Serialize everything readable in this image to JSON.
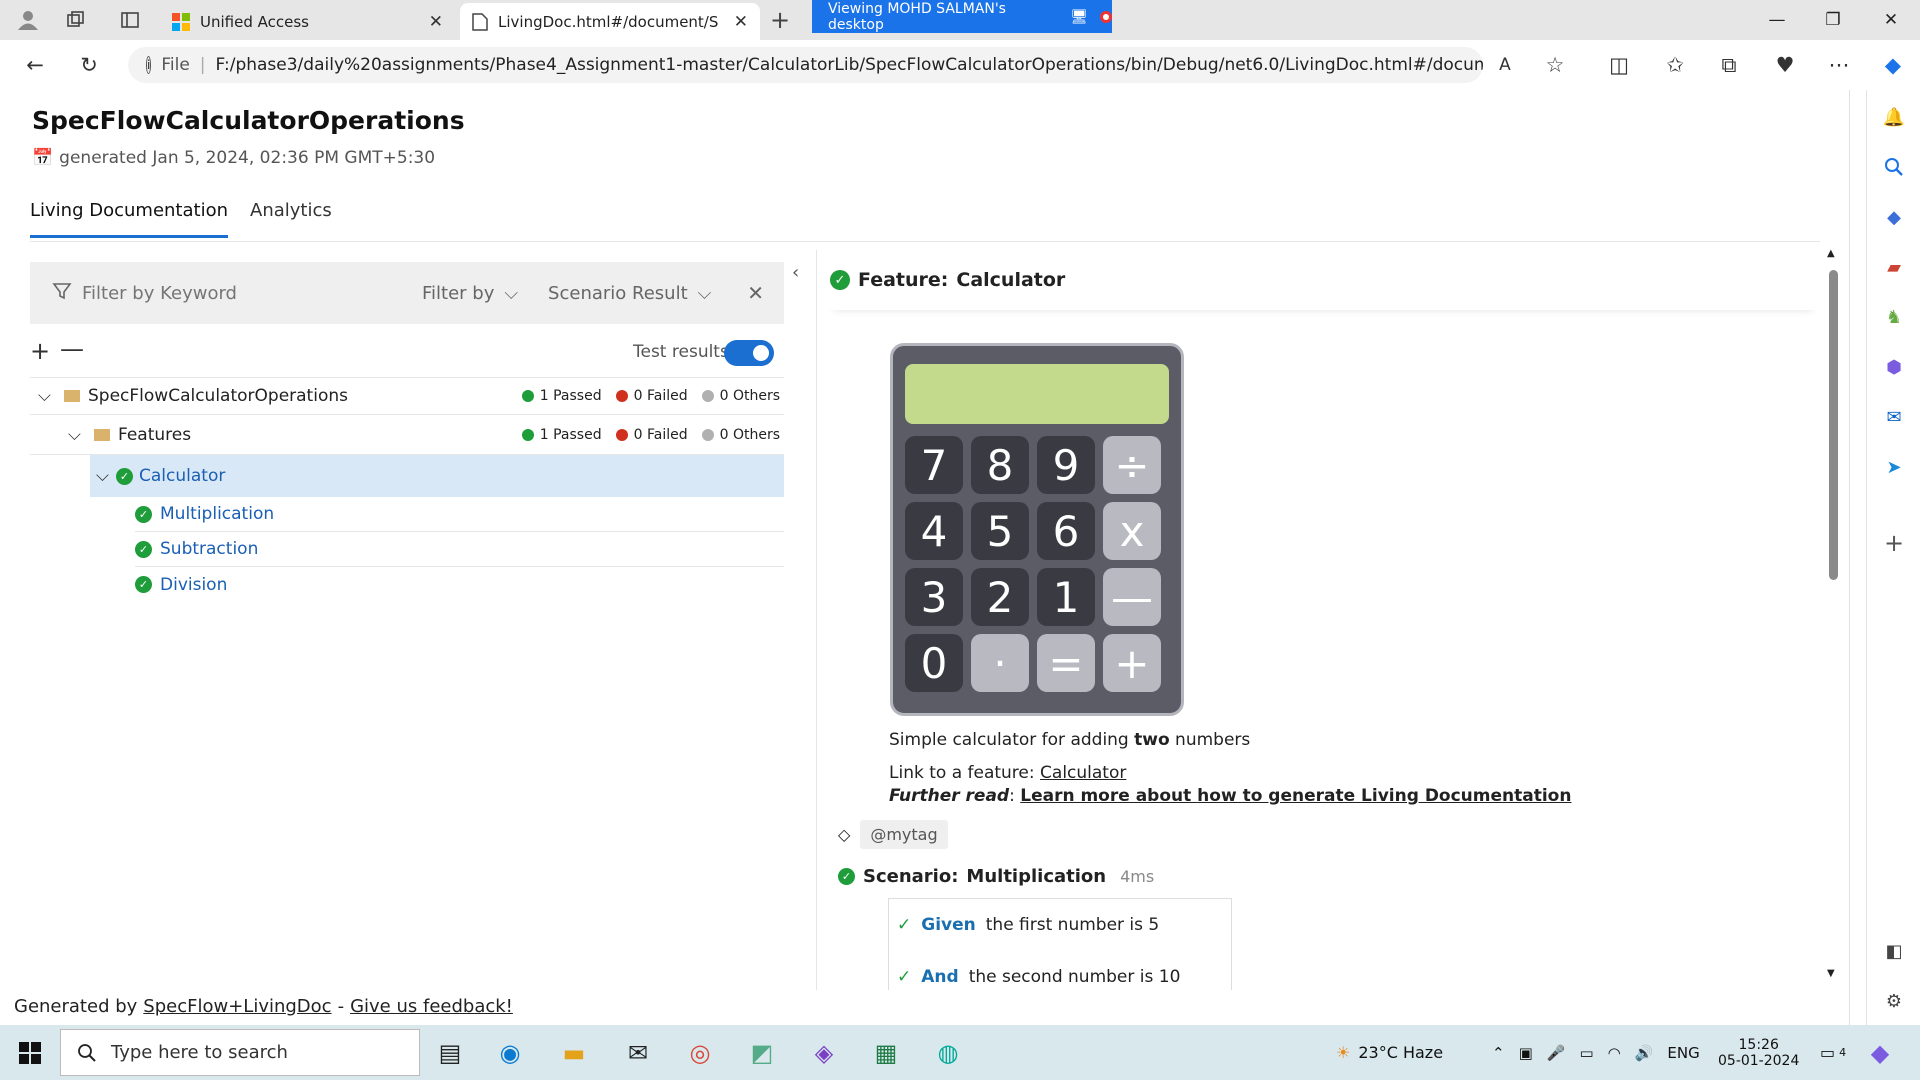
{
  "browser": {
    "tabs": [
      {
        "label": "Unified Access"
      },
      {
        "label": "LivingDoc.html#/document/Stan"
      }
    ],
    "remote_banner": "Viewing MOHD  SALMAN's desktop",
    "url_prefix": "File",
    "url": "F:/phase3/daily%20assignments/Phase4_Assignment1-master/CalculatorLib/SpecFlowCalculatorOperations/bin/Debug/net6.0/LivingDoc.html#/document/Stan..."
  },
  "page": {
    "title": "SpecFlowCalculatorOperations",
    "generated": "generated Jan 5, 2024, 02:36 PM GMT+5:30",
    "tabs": [
      "Living Documentation",
      "Analytics"
    ],
    "filter": {
      "placeholder": "Filter by Keyword",
      "filter_by": "Filter by",
      "scenario_result": "Scenario Result"
    },
    "test_results_label": "Test results",
    "tree": {
      "root": {
        "label": "SpecFlowCalculatorOperations",
        "passed": "1 Passed",
        "failed": "0 Failed",
        "others": "0 Others"
      },
      "features": {
        "label": "Features",
        "passed": "1 Passed",
        "failed": "0 Failed",
        "others": "0 Others"
      },
      "calculator": {
        "label": "Calculator"
      },
      "scenarios": [
        "Multiplication",
        "Subtraction",
        "Division"
      ]
    },
    "feature": {
      "heading_prefix": "Feature:",
      "heading_name": "Calculator",
      "calc_keys": [
        "7",
        "8",
        "9",
        "÷",
        "4",
        "5",
        "6",
        "x",
        "3",
        "2",
        "1",
        "—",
        "0",
        "·",
        "=",
        "+"
      ],
      "desc_before": "Simple calculator for adding ",
      "desc_bold": "two",
      "desc_after": " numbers",
      "link_prefix": "Link to a feature: ",
      "link_text": "Calculator",
      "further_label": "Further read",
      "further_link": "Learn more about how to generate Living Documentation",
      "tag": "@mytag",
      "scenario_prefix": "Scenario:",
      "scenario_name": "Multiplication",
      "scenario_time": "4ms",
      "steps": [
        {
          "keyword": "Given",
          "text": "the first number is 5"
        },
        {
          "keyword": "And",
          "text": "the second number is 10"
        }
      ]
    },
    "footer": {
      "prefix": "Generated by ",
      "link1": "SpecFlow+LivingDoc",
      "sep": " - ",
      "link2": "Give us feedback!"
    }
  },
  "taskbar": {
    "search_placeholder": "Type here to search",
    "weather": "23°C  Haze",
    "lang": "ENG",
    "time": "15:26",
    "date": "05-01-2024",
    "notif_count": "4"
  },
  "colors": {
    "accent": "#1a6fd0",
    "pass": "#1f9d3a",
    "fail": "#d0301e",
    "other": "#b0b0b0",
    "selected_row": "#d9e8f6"
  }
}
